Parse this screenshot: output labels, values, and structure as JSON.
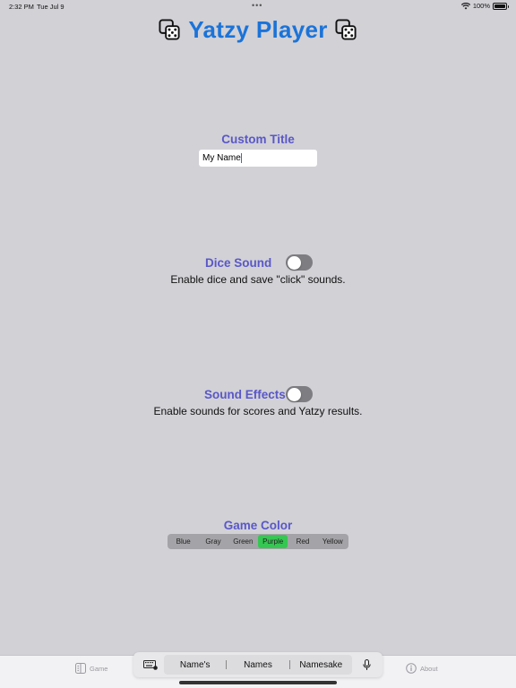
{
  "status": {
    "time": "2:32 PM",
    "date": "Tue Jul 9",
    "battery": "100%",
    "battery_level": 1.0
  },
  "header": {
    "title": "Yatzy Player",
    "left_icon": "dice-icon",
    "right_icon": "dice-icon",
    "title_color": "#1a73d9"
  },
  "custom_title": {
    "label": "Custom Title",
    "value": "My Name"
  },
  "dice_sound": {
    "label": "Dice Sound",
    "description": "Enable dice and save \"click\" sounds.",
    "enabled": false
  },
  "sound_effects": {
    "label": "Sound Effects",
    "description": "Enable sounds for scores and Yatzy results.",
    "enabled": false
  },
  "game_color": {
    "label": "Game Color",
    "options": [
      "Blue",
      "Gray",
      "Green",
      "Purple",
      "Red",
      "Yellow"
    ],
    "selected": "Purple",
    "selected_color": "#35c752"
  },
  "tab_bar": {
    "items": [
      {
        "label": "Game",
        "icon": "dice-grid-icon"
      },
      {
        "label": "About",
        "icon": "info-icon"
      }
    ]
  },
  "keyboard": {
    "icon": "keyboard-icon",
    "suggestions": [
      "Name's",
      "Names",
      "Namesake"
    ],
    "mic_icon": "microphone-icon"
  },
  "colors": {
    "background": "#d1d1d6",
    "label": "#5a57c8",
    "toggle_off": "#7e7e82"
  }
}
